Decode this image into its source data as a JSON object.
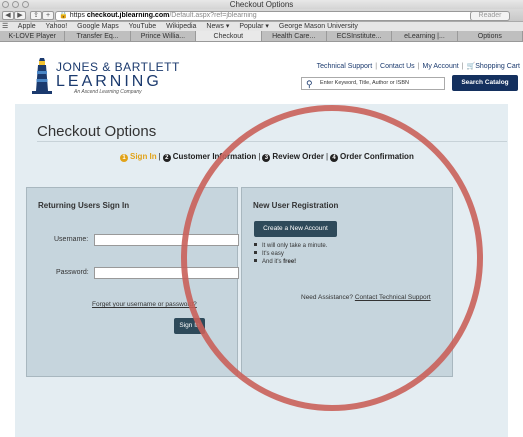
{
  "browser": {
    "window_title": "Checkout Options",
    "url_scheme": "https",
    "url_host": "checkout.jblearning.com",
    "url_path": "/Default.aspx?ref=jblearning",
    "reader_label": "Reader",
    "bookmarks": [
      "Apple",
      "Yahoo!",
      "Google Maps",
      "YouTube",
      "Wikipedia",
      "News ▾",
      "Popular ▾",
      "George Mason University"
    ],
    "tabs": [
      "K-LOVE Player",
      "Transfer Eq...",
      "Prince Willia...",
      "Checkout",
      "Health Care...",
      "ECSInstitute...",
      "eLearning |...",
      "Options"
    ]
  },
  "header": {
    "logo_line1": "JONES & BARTLETT",
    "logo_line2": "LEARNING",
    "logo_tagline": "An Ascend Learning Company",
    "links": [
      "Technical Support",
      "Contact Us",
      "My Account"
    ],
    "cart_label": "Shopping Cart",
    "search_placeholder": "Enter Keyword, Title, Author or ISBN",
    "search_button": "Search Catalog"
  },
  "main": {
    "title": "Checkout Options",
    "steps": [
      "Sign In",
      "Customer Information",
      "Review Order",
      "Order Confirmation"
    ],
    "step_numbers": [
      "1",
      "2",
      "3",
      "4"
    ],
    "active_step": 0
  },
  "returning": {
    "heading": "Returning Users Sign In",
    "username_label": "Username:",
    "password_label": "Password:",
    "forgot_link": "Forget your username or password?",
    "signin_button": "Sign In"
  },
  "new_user": {
    "heading": "New User Registration",
    "create_button": "Create a New Account",
    "bullet1": "It will only take a minute.",
    "bullet2": "It's easy",
    "bullet3_prefix": "And it's ",
    "bullet3_bold": "free!",
    "assist_prefix": "Need Assistance?",
    "assist_link": "Contact Technical Support"
  },
  "colors": {
    "brand_navy": "#14305e",
    "step_active": "#e1a31a",
    "annotation_circle": "#c9605a"
  }
}
